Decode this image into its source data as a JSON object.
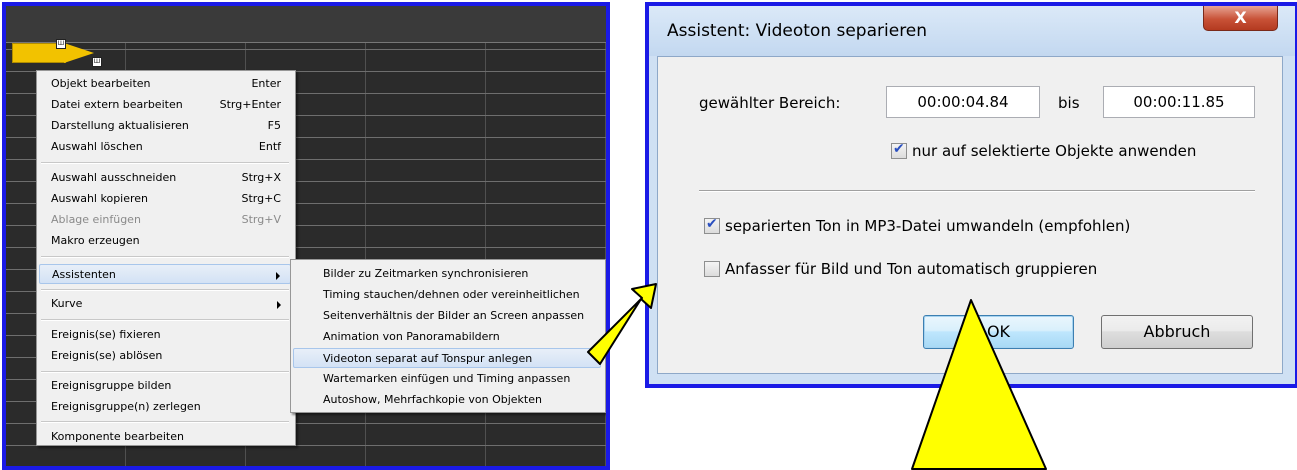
{
  "context_menu": {
    "items": [
      {
        "label": "Objekt bearbeiten",
        "shortcut": "Enter"
      },
      {
        "label": "Datei extern bearbeiten",
        "shortcut": "Strg+Enter"
      },
      {
        "label": "Darstellung aktualisieren",
        "shortcut": "F5"
      },
      {
        "label": "Auswahl löschen",
        "shortcut": "Entf"
      },
      {
        "label": "Auswahl ausschneiden",
        "shortcut": "Strg+X"
      },
      {
        "label": "Auswahl kopieren",
        "shortcut": "Strg+C"
      },
      {
        "label": "Ablage einfügen",
        "shortcut": "Strg+V"
      },
      {
        "label": "Makro erzeugen",
        "shortcut": ""
      },
      {
        "label": "Assistenten",
        "shortcut": ""
      },
      {
        "label": "Kurve",
        "shortcut": ""
      },
      {
        "label": "Ereignis(se) fixieren",
        "shortcut": ""
      },
      {
        "label": "Ereignis(se) ablösen",
        "shortcut": ""
      },
      {
        "label": "Ereignisgruppe bilden",
        "shortcut": ""
      },
      {
        "label": "Ereignisgruppe(n) zerlegen",
        "shortcut": ""
      },
      {
        "label": "Komponente bearbeiten",
        "shortcut": ""
      }
    ]
  },
  "submenu": {
    "items": [
      {
        "label": "Bilder zu Zeitmarken synchronisieren"
      },
      {
        "label": "Timing stauchen/dehnen oder vereinheitlichen"
      },
      {
        "label": "Seitenverhältnis der Bilder an Screen anpassen"
      },
      {
        "label": "Animation von Panoramabildern"
      },
      {
        "label": "Videoton separat auf Tonspur anlegen"
      },
      {
        "label": "Wartemarken einfügen und Timing anpassen"
      },
      {
        "label": "Autoshow, Mehrfachkopie von Objekten"
      }
    ]
  },
  "dialog": {
    "title": "Assistent: Videoton separieren",
    "close_glyph": "X",
    "range_label": "gewählter Bereich:",
    "range_from": "00:00:04.84",
    "range_to_label": "bis",
    "range_to": "00:00:11.85",
    "only_selected_label": "nur auf selektierte Objekte anwenden",
    "only_selected_checked": true,
    "convert_mp3_label": "separierten Ton in MP3-Datei umwandeln (empfohlen)",
    "convert_mp3_checked": true,
    "group_handles_label": "Anfasser für Bild und Ton automatisch gruppieren",
    "group_handles_checked": false,
    "ok_label": "OK",
    "cancel_label": "Abbruch"
  },
  "colors": {
    "frame_border": "#1a1ae6",
    "arrow_fill": "#ffff00",
    "clip_color": "#f2c200"
  }
}
